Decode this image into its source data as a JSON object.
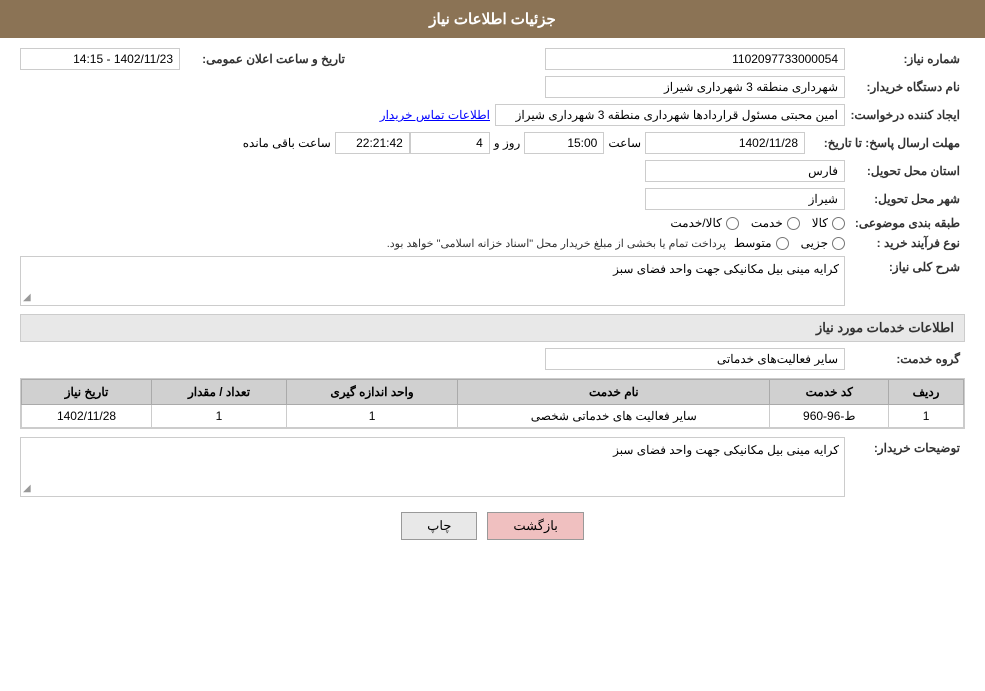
{
  "header": {
    "title": "جزئیات اطلاعات نیاز"
  },
  "form": {
    "shomareNiaz_label": "شماره نیاز:",
    "shomareNiaz_value": "1102097733000054",
    "namDastgah_label": "نام دستگاه خریدار:",
    "namDastgah_value": "شهرداری منطقه 3 شهرداری شیراز",
    "ijadKonande_label": "ایجاد کننده درخواست:",
    "ijadKonande_value": "امین محبتی مسئول قراردادها شهرداری منطقه 3 شهرداری شیراز",
    "etelaatTamas_link": "اطلاعات تماس خریدار",
    "mohlatErsal_label": "مهلت ارسال پاسخ: تا تاریخ:",
    "mohlatDate_value": "1402/11/28",
    "mohlatTime_label": "ساعت",
    "mohlatTime_value": "15:00",
    "mohlatRoz_label": "روز و",
    "mohlatRoz_value": "4",
    "mohlatSaat_label": "ساعت باقی مانده",
    "mohlatCountdown_value": "22:21:42",
    "announceDate_label": "تاریخ و ساعت اعلان عمومی:",
    "announceDate_value": "1402/11/23 - 14:15",
    "ostan_label": "استان محل تحویل:",
    "ostan_value": "فارس",
    "shahr_label": "شهر محل تحویل:",
    "shahr_value": "شیراز",
    "tabaqe_label": "طبقه بندی موضوعی:",
    "tabaqe_options": [
      {
        "label": "کالا",
        "checked": false
      },
      {
        "label": "خدمت",
        "checked": false
      },
      {
        "label": "کالا/خدمت",
        "checked": false
      }
    ],
    "noeFarayand_label": "نوع فرآیند خرید :",
    "noeFarayand_options": [
      {
        "label": "جزیی",
        "checked": false
      },
      {
        "label": "متوسط",
        "checked": false
      }
    ],
    "noeFarayand_note": "پرداخت تمام یا بخشی از مبلغ خریدار محل \"اسناد خزانه اسلامی\" خواهد بود.",
    "sharhKoli_label": "شرح کلی نیاز:",
    "sharhKoli_value": "کرایه مینی بیل مکانیکی جهت واحد فضای سبز",
    "serviceInfo_title": "اطلاعات خدمات مورد نیاز",
    "groheKhedmat_label": "گروه خدمت:",
    "groheKhedmat_value": "سایر فعالیت‌های خدماتی",
    "table": {
      "headers": [
        "ردیف",
        "کد خدمت",
        "نام خدمت",
        "واحد اندازه گیری",
        "تعداد / مقدار",
        "تاریخ نیاز"
      ],
      "rows": [
        {
          "radif": "1",
          "kodKhedmat": "ط-96-960",
          "namKhedmat": "سایر فعالیت های خدماتی شخصی",
          "vahed": "1",
          "tedad": "1",
          "tarikh": "1402/11/28"
        }
      ]
    },
    "tozihat_label": "توضیحات خریدار:",
    "tozihat_value": "کرایه مینی بیل مکانیکی جهت واحد فضای سبز"
  },
  "buttons": {
    "print_label": "چاپ",
    "back_label": "بازگشت"
  }
}
